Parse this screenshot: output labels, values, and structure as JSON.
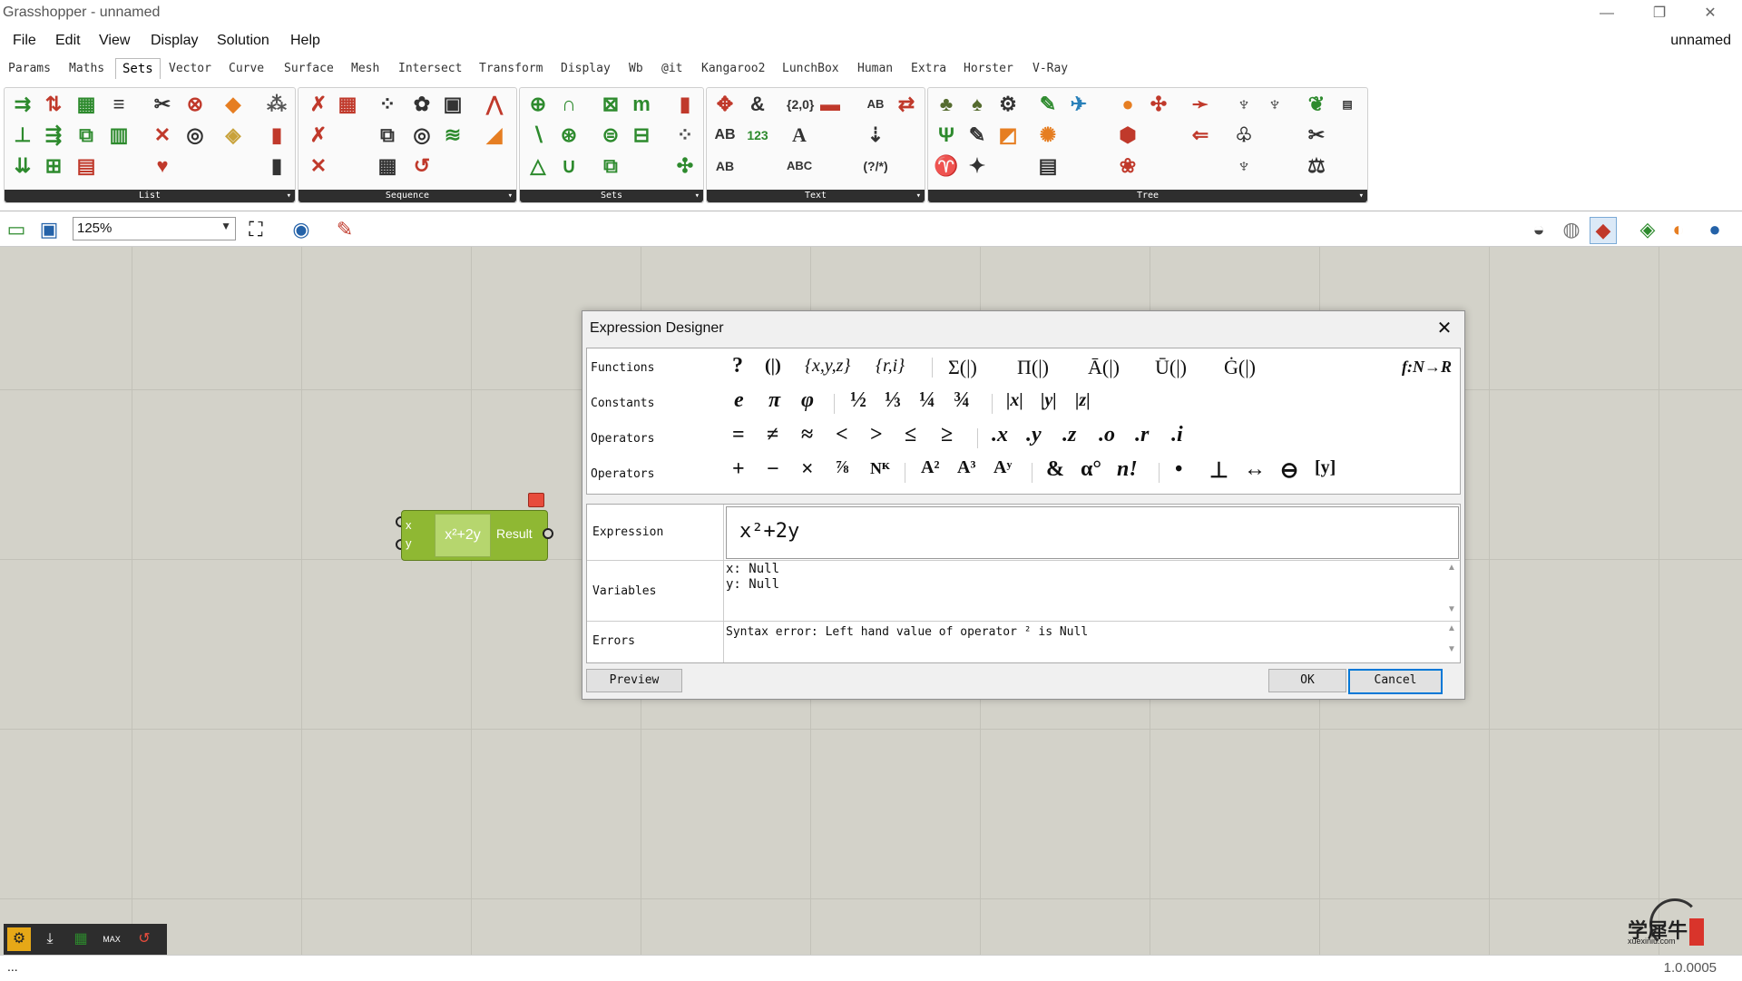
{
  "window": {
    "title": "Grasshopper - unnamed",
    "minimize": "—",
    "restore": "❐",
    "close": "✕"
  },
  "menu": {
    "items": [
      "File",
      "Edit",
      "View",
      "Display",
      "Solution",
      "Help"
    ],
    "doc_name": "unnamed"
  },
  "tabs": [
    "Params",
    "Maths",
    "Sets",
    "Vector",
    "Curve",
    "Surface",
    "Mesh",
    "Intersect",
    "Transform",
    "Display",
    "Wb",
    "@it",
    "Kangaroo2",
    "LunchBox",
    "Human",
    "Extra",
    "Horster",
    "V-Ray"
  ],
  "active_tab": "Sets",
  "ribbon": {
    "panels": [
      "List",
      "Sequence",
      "Sets",
      "Text",
      "Tree"
    ],
    "expand": "▾"
  },
  "toolbar": {
    "zoom": "125%"
  },
  "component": {
    "inputs": [
      "x",
      "y"
    ],
    "expression": "x²+2y",
    "output": "Result"
  },
  "dialog": {
    "title": "Expression Designer",
    "close": "✕",
    "rows": [
      "Functions",
      "Constants",
      "Operators",
      "Operators"
    ],
    "functions": [
      "?",
      "(|)",
      "{x,y,z}",
      "{r,i}",
      "Σ(|)",
      "Π(|)",
      "Ā(|)",
      "Ū(|)",
      "Ġ(|)",
      "f:N→R"
    ],
    "constants": [
      "e",
      "π",
      "φ",
      "½",
      "⅓",
      "¼",
      "¾",
      "|x|",
      "|y|",
      "|z|"
    ],
    "operators1": [
      "=",
      "≠",
      "≈",
      "<",
      ">",
      "≤",
      "≥",
      ".x",
      ".y",
      ".z",
      ".o",
      ".r",
      ".i"
    ],
    "operators2": [
      "+",
      "−",
      "×",
      "⅞",
      "Nᴷ",
      "A²",
      "A³",
      "Aʸ",
      "&",
      "α°",
      "n!",
      "•",
      "⊥",
      "↔",
      "⊖",
      "[y]"
    ],
    "expression_label": "Expression",
    "expression": "x²+2y",
    "variables_label": "Variables",
    "variables": "x: Null\ny: Null",
    "errors_label": "Errors",
    "errors": "Syntax error: Left hand value of operator ² is Null",
    "preview": "Preview",
    "ok": "OK",
    "cancel": "Cancel"
  },
  "status": {
    "left": "...",
    "version": "1.0.0005"
  },
  "watermark": {
    "brand": "学犀牛",
    "url": "xuexiniu.com"
  }
}
